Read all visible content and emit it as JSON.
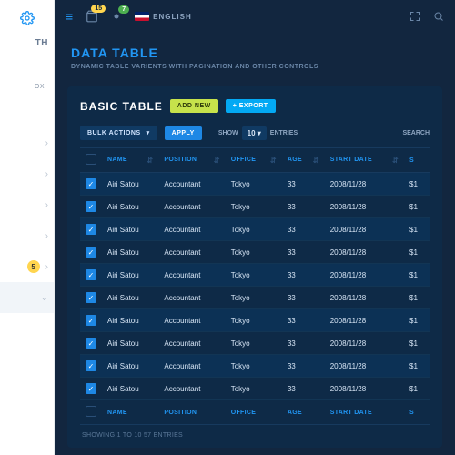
{
  "sidebar": {
    "label_th": "TH",
    "label_ox": "OX",
    "badge": "5"
  },
  "topbar": {
    "badge1": "15",
    "badge2": "7",
    "lang": "ENGLISH"
  },
  "page": {
    "title": "DATA TABLE",
    "subtitle": "DYNAMIC TABLE VARIENTS WITH PAGINATION AND OTHER CONTROLS"
  },
  "card": {
    "title": "BASIC TABLE",
    "add_new": "ADD NEW",
    "export": "+ EXPORT",
    "bulk_actions": "BULK ACTIONS",
    "apply": "APPLY",
    "show": "SHOW",
    "page_size": "10",
    "entries": "ENTRIES",
    "search": "SEARCH",
    "footnote": "SHOWING 1 TO 10 57 ENTRIES"
  },
  "columns": {
    "name": "NAME",
    "position": "POSITION",
    "office": "OFFICE",
    "age": "AGE",
    "start": "START DATE",
    "salary": "S"
  },
  "rows": [
    {
      "name": "Airi Satou",
      "position": "Accountant",
      "office": "Tokyo",
      "age": "33",
      "start": "2008/11/28",
      "salary": "$1"
    },
    {
      "name": "Airi Satou",
      "position": "Accountant",
      "office": "Tokyo",
      "age": "33",
      "start": "2008/11/28",
      "salary": "$1"
    },
    {
      "name": "Airi Satou",
      "position": "Accountant",
      "office": "Tokyo",
      "age": "33",
      "start": "2008/11/28",
      "salary": "$1"
    },
    {
      "name": "Airi Satou",
      "position": "Accountant",
      "office": "Tokyo",
      "age": "33",
      "start": "2008/11/28",
      "salary": "$1"
    },
    {
      "name": "Airi Satou",
      "position": "Accountant",
      "office": "Tokyo",
      "age": "33",
      "start": "2008/11/28",
      "salary": "$1"
    },
    {
      "name": "Airi Satou",
      "position": "Accountant",
      "office": "Tokyo",
      "age": "33",
      "start": "2008/11/28",
      "salary": "$1"
    },
    {
      "name": "Airi Satou",
      "position": "Accountant",
      "office": "Tokyo",
      "age": "33",
      "start": "2008/11/28",
      "salary": "$1"
    },
    {
      "name": "Airi Satou",
      "position": "Accountant",
      "office": "Tokyo",
      "age": "33",
      "start": "2008/11/28",
      "salary": "$1"
    },
    {
      "name": "Airi Satou",
      "position": "Accountant",
      "office": "Tokyo",
      "age": "33",
      "start": "2008/11/28",
      "salary": "$1"
    },
    {
      "name": "Airi Satou",
      "position": "Accountant",
      "office": "Tokyo",
      "age": "33",
      "start": "2008/11/28",
      "salary": "$1"
    }
  ]
}
